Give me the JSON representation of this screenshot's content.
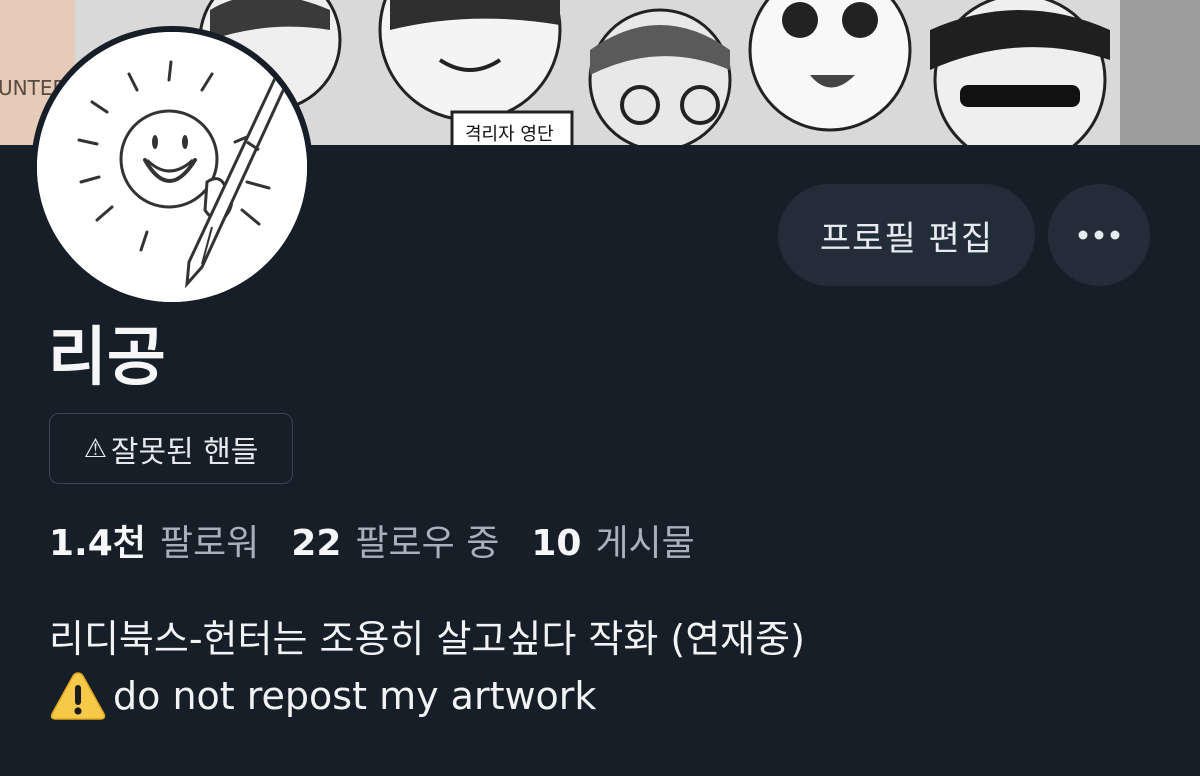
{
  "profile": {
    "display_name": "리공",
    "handle_label": "잘못된 핸들",
    "warning_symbol": "⚠",
    "edit_button_label": "프로필 편집",
    "more_button_label": "•••"
  },
  "banner": {
    "text_fragment": "UNTEF",
    "sign_text": "격리자 영단",
    "background_color": "#cfcfcf"
  },
  "stats": [
    {
      "value": "1.4천",
      "label": "팔로워"
    },
    {
      "value": "22",
      "label": "팔로우 중"
    },
    {
      "value": "10",
      "label": "게시물"
    }
  ],
  "bio": {
    "line1": "리디북스-헌터는 조용히 살고싶다 작화 (연재중)",
    "line2": "do not repost my artwork",
    "line2_icon": "warning-emoji-icon"
  },
  "colors": {
    "background": "#161e27",
    "button_bg": "#232d3a",
    "muted_text": "#a7b0bb",
    "warning_yellow": "#f7c948"
  }
}
